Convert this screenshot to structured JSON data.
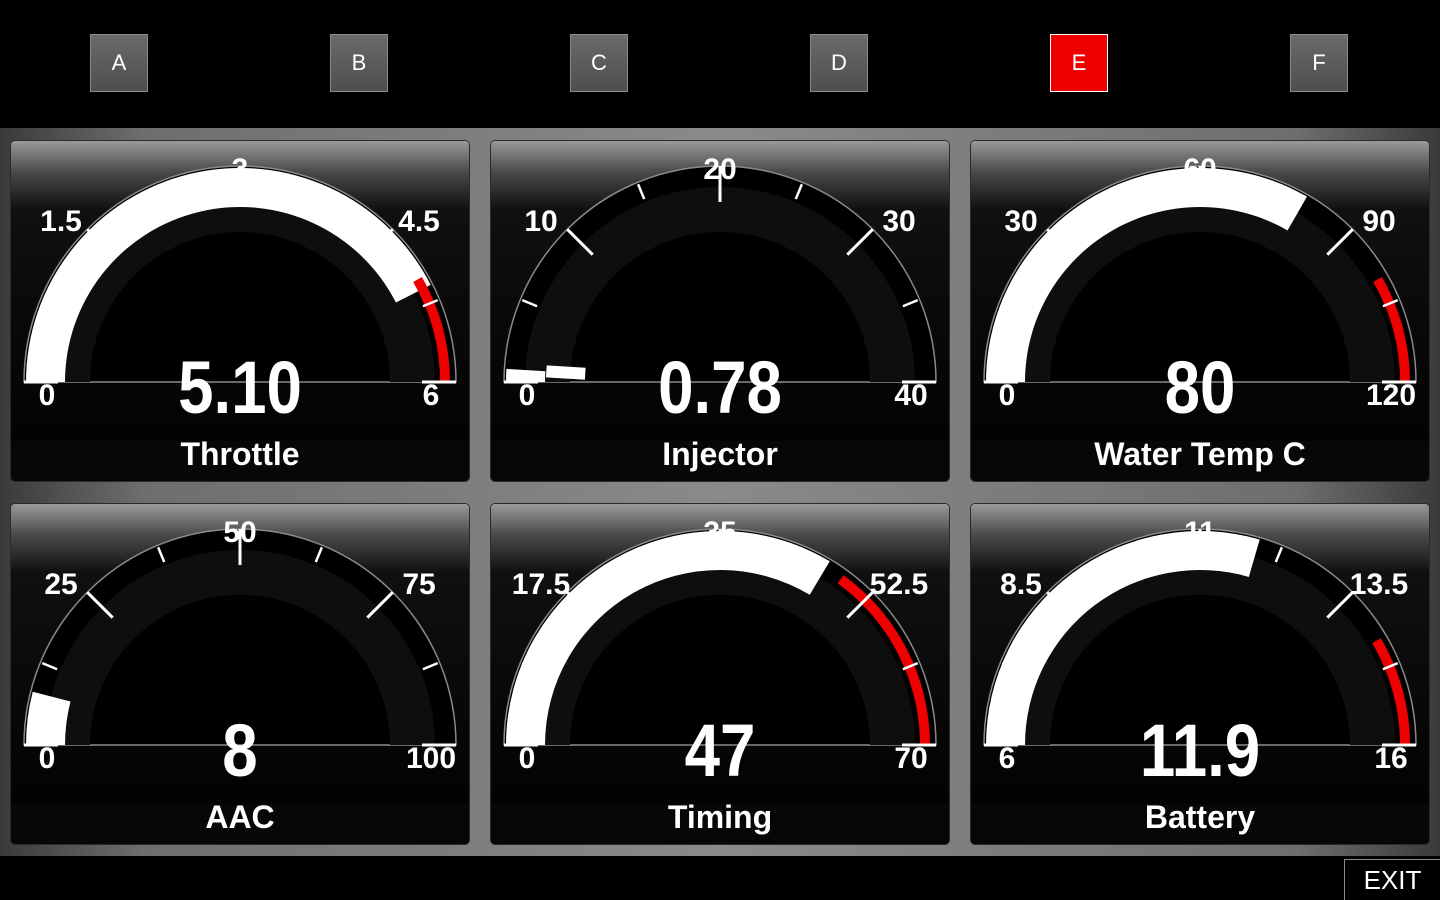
{
  "tabs": [
    {
      "label": "A",
      "active": false
    },
    {
      "label": "B",
      "active": false
    },
    {
      "label": "C",
      "active": false
    },
    {
      "label": "D",
      "active": false
    },
    {
      "label": "E",
      "active": true
    },
    {
      "label": "F",
      "active": false
    }
  ],
  "exit_label": "EXIT",
  "colors": {
    "active_tab": "#ee0000",
    "redline": "#ee0000",
    "bar": "#ffffff"
  },
  "gauges": [
    {
      "label": "Throttle",
      "value": 5.1,
      "display": "5.10",
      "min": 0,
      "max": 6,
      "ticks": [
        "0",
        "1.5",
        "3",
        "4.5",
        "6"
      ],
      "redline_from": 5.0
    },
    {
      "label": "Injector",
      "value": 0.78,
      "display": "0.78",
      "min": 0,
      "max": 40,
      "ticks": [
        "0",
        "10",
        "20",
        "30",
        "40"
      ],
      "redline_from": null
    },
    {
      "label": "Water Temp C",
      "value": 80,
      "display": "80",
      "min": 0,
      "max": 120,
      "ticks": [
        "0",
        "30",
        "60",
        "90",
        "120"
      ],
      "redline_from": 100
    },
    {
      "label": "AAC",
      "value": 8,
      "display": "8",
      "min": 0,
      "max": 100,
      "ticks": [
        "0",
        "25",
        "50",
        "75",
        "100"
      ],
      "redline_from": null
    },
    {
      "label": "Timing",
      "value": 47,
      "display": "47",
      "min": 0,
      "max": 70,
      "ticks": [
        "0",
        "17.5",
        "35",
        "52.5",
        "70"
      ],
      "redline_from": 49
    },
    {
      "label": "Battery",
      "value": 11.9,
      "display": "11.9",
      "min": 6,
      "max": 16,
      "ticks": [
        "6",
        "8.5",
        "11",
        "13.5",
        "16"
      ],
      "redline_from": 14.3
    }
  ]
}
